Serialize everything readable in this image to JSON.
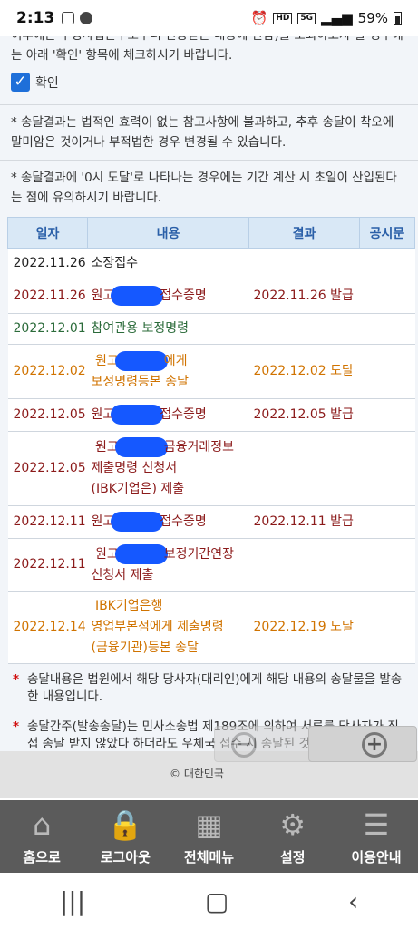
{
  "statusbar": {
    "time": "2:13",
    "hd": "HD",
    "network": "5G",
    "battery": "59%"
  },
  "notices": {
    "top": "이후에는 우정사업본부로부터 전송받은 내용에 한함)를 조회하고자 할 경우에는 아래 '확인' 항목에 체크하시기 바랍니다.",
    "confirm_label": "확인",
    "note1": "* 송달결과는 법적인 효력이 없는 참고사항에 불과하고, 추후 송달이 착오에 말미암은 것이거나 부적법한 경우 변경될 수 있습니다.",
    "note2": "* 송달결과에 '0시 도달'로 나타나는 경우에는 기간 계산 시 초일이 산입된다는 점에 유의하시기 바랍니다."
  },
  "table": {
    "headers": {
      "date": "일자",
      "content": "내용",
      "result": "결과",
      "notice": "공시문"
    },
    "rows": [
      {
        "date": "2022.11.26",
        "content": "소장접수",
        "result": ""
      },
      {
        "date": "2022.11.26",
        "c1": "원고",
        "c2": "접수증명",
        "result": "2022.11.26 발급"
      },
      {
        "date": "2022.12.01",
        "content": "참여관용 보정명령",
        "result": ""
      },
      {
        "date": "2022.12.02",
        "c1": "원고",
        "c2": "에게",
        "c3": "보정명령등본 송달",
        "result": "2022.12.02 도달"
      },
      {
        "date": "2022.12.05",
        "c1": "원고",
        "c2": "접수증명",
        "result": "2022.12.05 발급"
      },
      {
        "date": "2022.12.05",
        "c1": "원고",
        "c2": "금융거래정보",
        "c3": "제출명령 신청서",
        "c4": "(IBK기업은) 제출",
        "result": ""
      },
      {
        "date": "2022.12.11",
        "c1": "원고",
        "c2": "접수증명",
        "result": "2022.12.11 발급"
      },
      {
        "date": "2022.12.11",
        "c1": "원고",
        "c2": "보정기간연장",
        "c3": "신청서 제출",
        "result": ""
      },
      {
        "date": "2022.12.14",
        "c1": "IBK기업은행",
        "c2": "영업부본점에게 제출명령",
        "c3": "(금융기관)등본 송달",
        "result": "2022.12.19 도달"
      }
    ]
  },
  "notes": {
    "n1": "송달내용은 법원에서 해당 당사자(대리인)에게 해당 내용의 송달물을 발송한 내용입니다.",
    "n2": "송달간주(발송송달)는 민사소송법 제189조에 의하여 서류를 당사자가 직접 송달 받지 않았다 하더라도 우체국 접수 시 송달된 것으로 간주되어 송달효력이 발생하는 제도입니다."
  },
  "footer": {
    "copyright": "© 대한민국"
  },
  "nav": [
    {
      "label": "홈으로",
      "icon": "home-icon"
    },
    {
      "label": "로그아웃",
      "icon": "lock-icon"
    },
    {
      "label": "전체메뉴",
      "icon": "grid-icon"
    },
    {
      "label": "설정",
      "icon": "settings-icon"
    },
    {
      "label": "이용안내",
      "icon": "guide-icon"
    }
  ],
  "colors": {
    "accent": "#1e6fd9",
    "header_bg": "#d9e8f6",
    "nav_bg": "#5b5b5b"
  }
}
